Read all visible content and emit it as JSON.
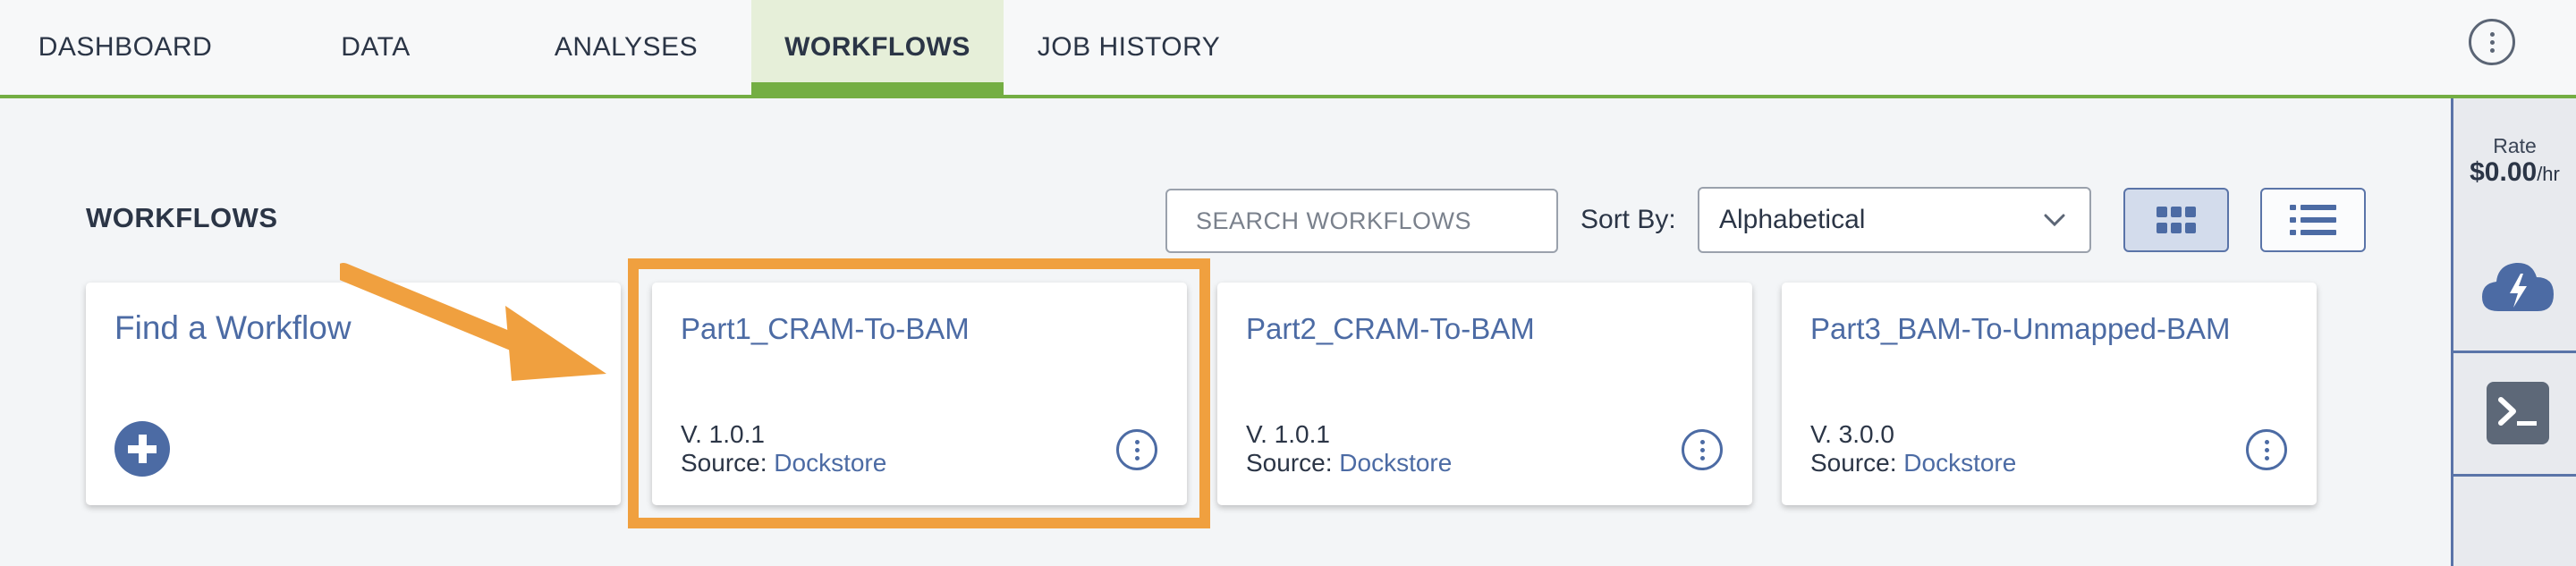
{
  "nav": {
    "tabs": [
      {
        "label": "DASHBOARD"
      },
      {
        "label": "DATA"
      },
      {
        "label": "ANALYSES"
      },
      {
        "label": "WORKFLOWS"
      },
      {
        "label": "JOB HISTORY"
      }
    ],
    "active_tab": "WORKFLOWS",
    "accent_color": "#74ae43"
  },
  "sidebar": {
    "rate_label": "Rate",
    "rate_value": "$0.00",
    "rate_unit": "/hr",
    "cloud_icon": "cloud-lightning-icon",
    "terminal_icon": "terminal-icon"
  },
  "toolbar": {
    "section_title": "WORKFLOWS",
    "search_placeholder": "SEARCH WORKFLOWS",
    "sort_label": "Sort By:",
    "sort_value": "Alphabetical",
    "grid_view_icon": "grid-view-icon",
    "list_view_icon": "list-view-icon"
  },
  "find_card": {
    "title": "Find a Workflow"
  },
  "cards": [
    {
      "title": "Part1_CRAM-To-BAM",
      "version": "V. 1.0.1",
      "source_prefix": "Source:",
      "source": "Dockstore"
    },
    {
      "title": "Part2_CRAM-To-BAM",
      "version": "V. 1.0.1",
      "source_prefix": "Source:",
      "source": "Dockstore"
    },
    {
      "title": "Part3_BAM-To-Unmapped-BAM",
      "version": "V. 3.0.0",
      "source_prefix": "Source:",
      "source": "Dockstore"
    }
  ],
  "colors": {
    "link": "#4c6ba4",
    "highlight": "#f0a03f"
  }
}
